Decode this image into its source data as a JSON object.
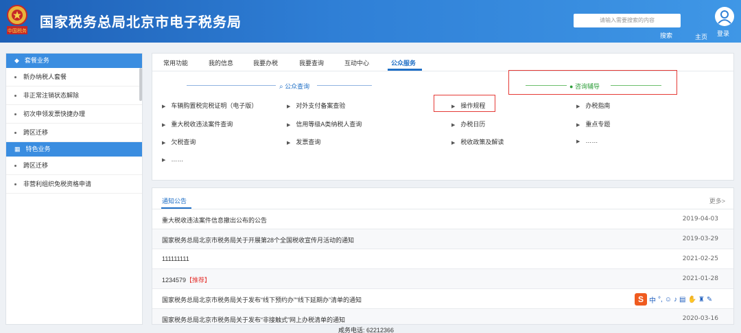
{
  "header": {
    "title": "国家税务总局北京市电子税务局",
    "search_placeholder": "请输入需要搜索的内容",
    "search_label": "搜索",
    "home_label": "主页",
    "login_label": "登录",
    "emblem_text": "中国税务"
  },
  "sidebar": {
    "section1": "套餐业务",
    "items1": [
      "新办纳税人套餐",
      "非正常注销状态解除",
      "初次申领发票快捷办理",
      "跨区迁移"
    ],
    "section2": "特色业务",
    "items2": [
      "跨区迁移",
      "非营利组织免税资格申请"
    ]
  },
  "tabs": [
    "常用功能",
    "我的信息",
    "我要办税",
    "我要查询",
    "互动中心",
    "公众服务"
  ],
  "public_query": {
    "title": "公众查询",
    "col1": [
      "车辆购置税完税证明（电子版）",
      "重大税收违法案件查询",
      "欠税查询",
      "……"
    ],
    "col2": [
      "对外支付备案查验",
      "信用等级A类纳税人查询",
      "发票查询"
    ]
  },
  "consult": {
    "title": "咨询辅导",
    "col1": [
      "操作规程",
      "办税日历",
      "税收政策及解读"
    ],
    "col2": [
      "办税指南",
      "重点专题",
      "……"
    ]
  },
  "notices": {
    "tab": "通知公告",
    "more": "更多>",
    "rows": [
      {
        "title": "重大税收违法案件信息撤出公布的公告",
        "tag": "",
        "date": "2019-04-03"
      },
      {
        "title": "国家税务总局北京市税务局关于开展第28个全国税收宣传月活动的通知",
        "tag": "",
        "date": "2019-03-29"
      },
      {
        "title": "111111111",
        "tag": "",
        "date": "2021-02-25"
      },
      {
        "title": "1234579",
        "tag": "【推荐】",
        "date": "2021-01-28"
      },
      {
        "title": "国家税务总局北京市税务局关于发布“线下预约办”“线下延期办”清单的通知",
        "tag": "",
        "date": ""
      },
      {
        "title": "国家税务总局北京市税务局关于发布“非接触式”网上办税清单的通知",
        "tag": "",
        "date": "2020-03-16"
      }
    ]
  },
  "ime": {
    "logo": "S",
    "lang": "中"
  },
  "footer": {
    "tel": "咸务电话: 62212366"
  }
}
